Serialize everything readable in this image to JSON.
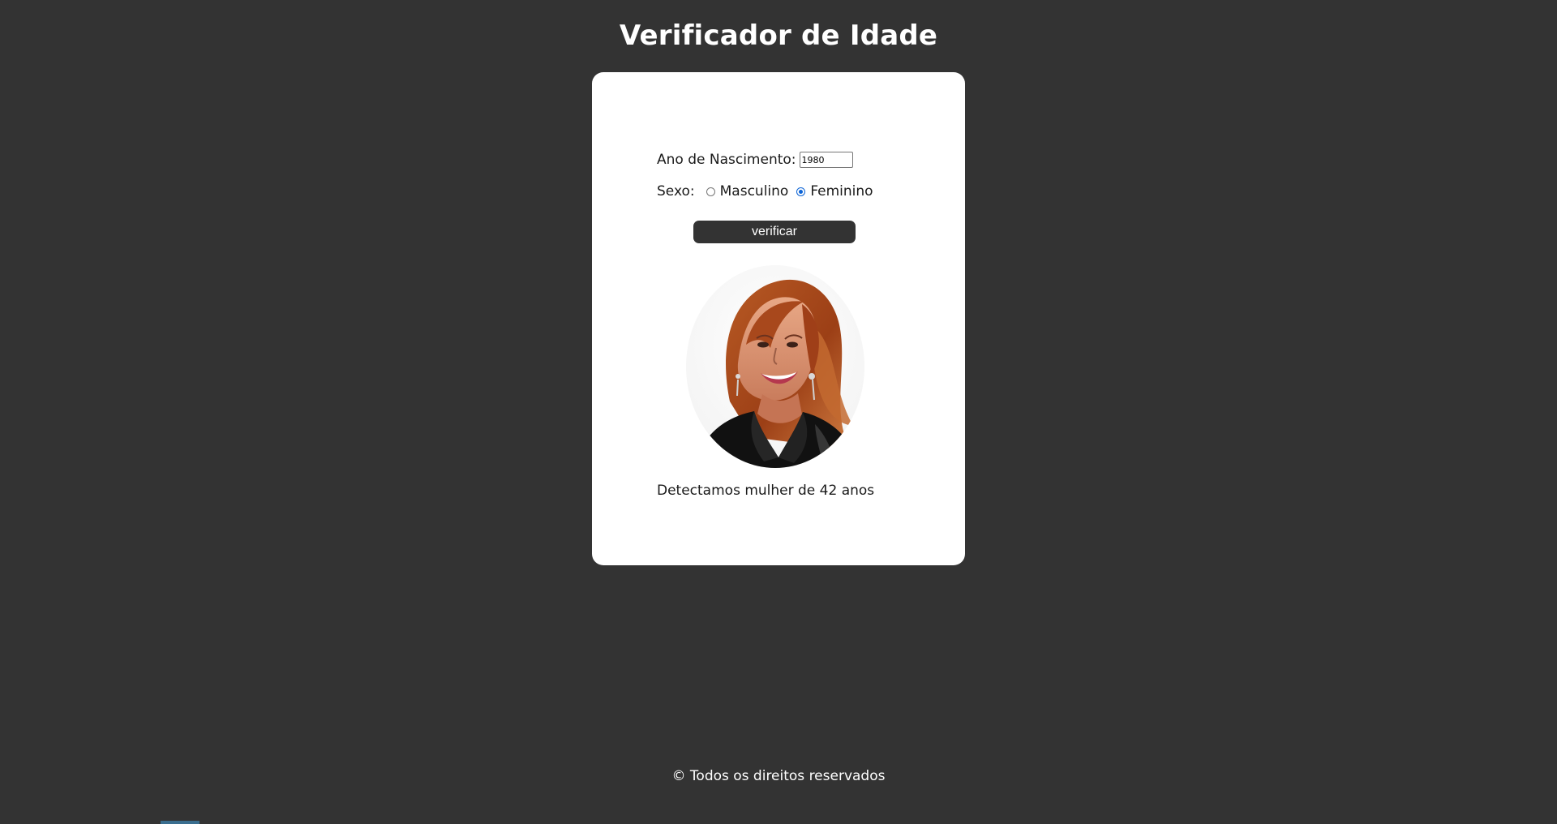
{
  "header": {
    "title": "Verificador de Idade"
  },
  "form": {
    "birth_year_label": "Ano de Nascimento:",
    "birth_year_value": "1980",
    "sex_label": "Sexo:",
    "options": [
      {
        "label": "Masculino",
        "checked": false
      },
      {
        "label": "Feminino",
        "checked": true
      }
    ],
    "submit_label": "verificar"
  },
  "result": {
    "image_icon": "woman-portrait-photo",
    "text": "Detectamos mulher de 42 anos"
  },
  "footer": {
    "text": "© Todos os direitos reservados"
  },
  "colors": {
    "background": "#333333",
    "card": "#ffffff",
    "button": "#333333",
    "radio_accent": "#0b63d6"
  }
}
